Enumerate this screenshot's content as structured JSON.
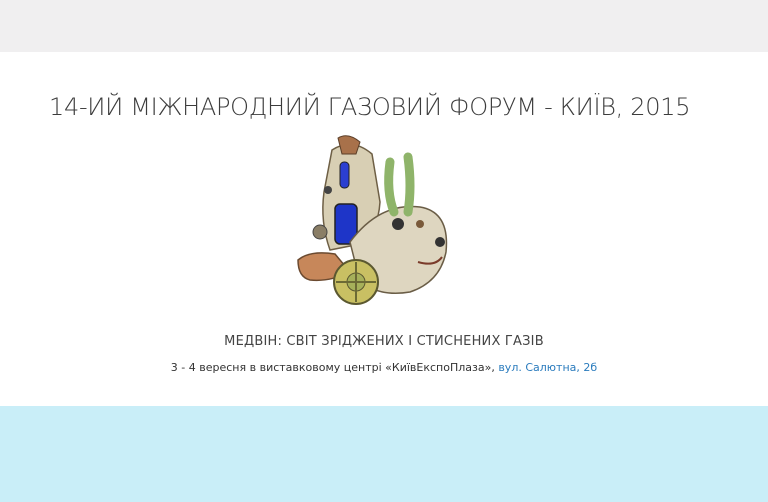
{
  "page": {
    "title": "14-ИЙ МІЖНАРОДНИЙ ГАЗОВИЙ ФОРУМ - КИЇВ, 2015",
    "subtitle": "МЕДВІН: СВІТ ЗРІДЖЕНИХ І СТИСНЕНИХ ГАЗІВ",
    "event_text": "3 - 4 вересня в виставковому центрі «КиївЕкспоПлаза», ",
    "address_link": "вул. Салютна, 2б"
  },
  "colors": {
    "top_band": "#f0eff0",
    "bottom_band": "#c9eef8",
    "link": "#2a7bbd"
  }
}
